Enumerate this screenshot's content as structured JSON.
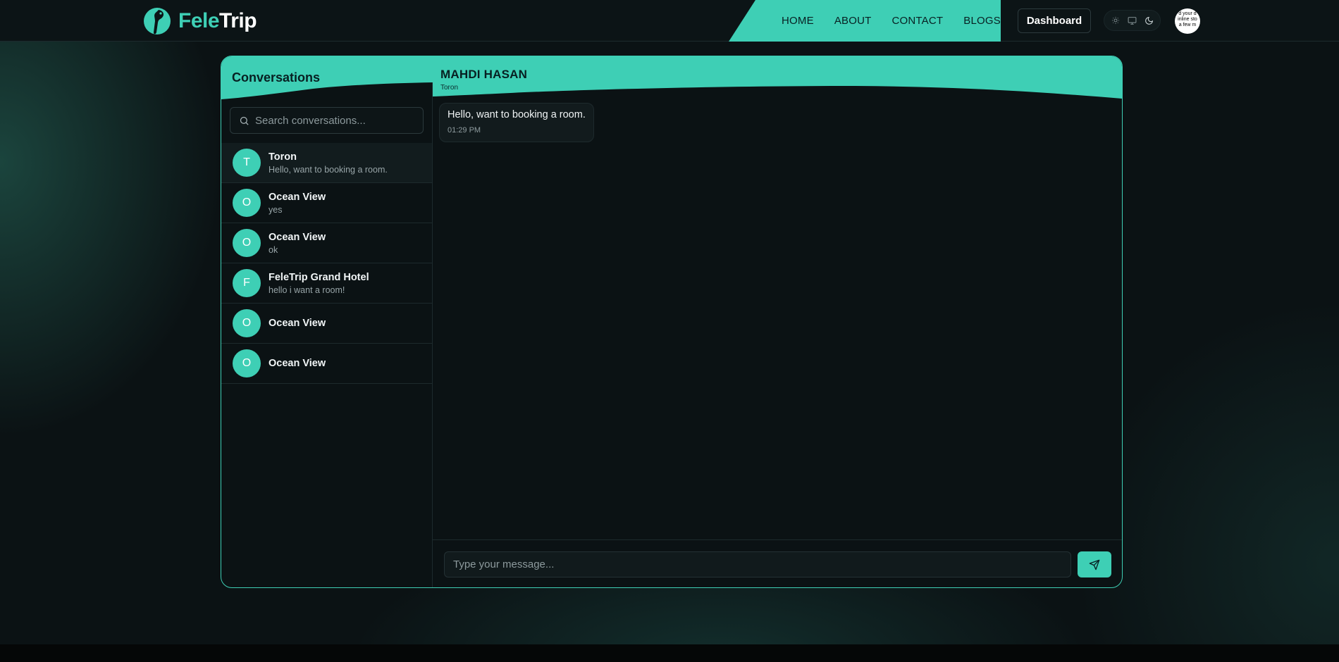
{
  "brand": {
    "name_part1": "Fele",
    "name_part2": "Trip",
    "accent": "#3ecfb5"
  },
  "nav": {
    "links": [
      "HOME",
      "ABOUT",
      "CONTACT",
      "BLOGS"
    ],
    "dashboard_label": "Dashboard"
  },
  "theme_toggle": {
    "options": [
      "sun-icon",
      "monitor-icon",
      "moon-icon"
    ]
  },
  "user_avatar": {
    "alt_text_lines": [
      "d your d",
      "inline sto",
      "a few m"
    ]
  },
  "sidebar": {
    "title": "Conversations",
    "search_placeholder": "Search conversations...",
    "conversations": [
      {
        "initial": "T",
        "name": "Toron",
        "last": "Hello, want to booking a room.",
        "active": true
      },
      {
        "initial": "O",
        "name": "Ocean View",
        "last": "yes"
      },
      {
        "initial": "O",
        "name": "Ocean View",
        "last": "ok"
      },
      {
        "initial": "F",
        "name": "FeleTrip Grand Hotel",
        "last": "hello i want a room!"
      },
      {
        "initial": "O",
        "name": "Ocean View",
        "last": ""
      },
      {
        "initial": "O",
        "name": "Ocean View",
        "last": ""
      }
    ]
  },
  "chat": {
    "name": "MAHDI HASAN",
    "subtitle": "Toron",
    "messages": [
      {
        "text": "Hello, want to booking a room.",
        "time": "01:29 PM"
      }
    ],
    "input_placeholder": "Type your message..."
  }
}
